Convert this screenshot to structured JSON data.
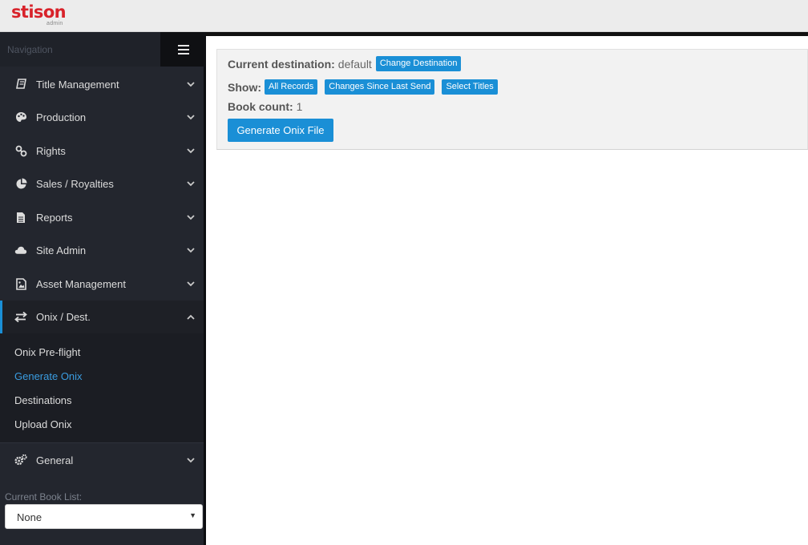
{
  "header": {
    "logo_text": "stison",
    "logo_sub": "admin"
  },
  "sidebar": {
    "nav_label": "Navigation",
    "menu_icon": "hamburger-icon",
    "items": [
      {
        "label": "Title Management",
        "icon": "book-icon"
      },
      {
        "label": "Production",
        "icon": "palette-icon"
      },
      {
        "label": "Rights",
        "icon": "link-icon"
      },
      {
        "label": "Sales / Royalties",
        "icon": "pie-chart-icon"
      },
      {
        "label": "Reports",
        "icon": "file-icon"
      },
      {
        "label": "Site Admin",
        "icon": "cloud-icon"
      },
      {
        "label": "Asset Management",
        "icon": "image-file-icon"
      },
      {
        "label": "Onix / Dest.",
        "icon": "exchange-icon"
      },
      {
        "label": "General",
        "icon": "gears-icon"
      }
    ],
    "subitems": [
      {
        "label": "Onix Pre-flight"
      },
      {
        "label": "Generate Onix"
      },
      {
        "label": "Destinations"
      },
      {
        "label": "Upload Onix"
      }
    ],
    "current_book_list_label": "Current Book List:",
    "current_book_list_value": "None"
  },
  "main": {
    "destination_label": "Current destination:",
    "destination_value": "default",
    "change_destination_button": "Change Destination",
    "show_label": "Show:",
    "show_buttons": [
      "All Records",
      "Changes Since Last Send",
      "Select Titles"
    ],
    "book_count_label": "Book count:",
    "book_count_value": "1",
    "generate_button": "Generate Onix File"
  },
  "colors": {
    "accent": "#1a8fd6",
    "sidebar_bg": "#23262e",
    "brand_red": "#d8222a"
  }
}
